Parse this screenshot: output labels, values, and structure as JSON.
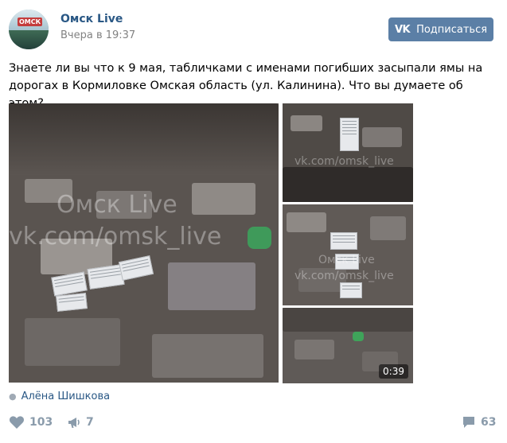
{
  "header": {
    "avatar_label": "ОМСК",
    "page_name": "Омск Live",
    "timestamp": "Вчера в 19:37",
    "subscribe_icon": "vk-logo-icon",
    "subscribe_label": "Подписаться"
  },
  "post": {
    "text": "Знаете ли вы что к 9 мая, табличками с именами погибших засыпали ямы на дорогах в Кормиловке Омская область (ул. Калинина). Что вы думаете об этом?",
    "watermark_title": "Омск Live",
    "watermark_url": "vk.com/omsk_live",
    "video_duration": "0:39",
    "author": "Алёна Шишкова"
  },
  "actions": {
    "likes": "103",
    "reposts": "7",
    "comments": "63"
  },
  "colors": {
    "link": "#2a5885",
    "button": "#5b7fa6",
    "muted": "#828282",
    "action": "#8a9bab"
  }
}
